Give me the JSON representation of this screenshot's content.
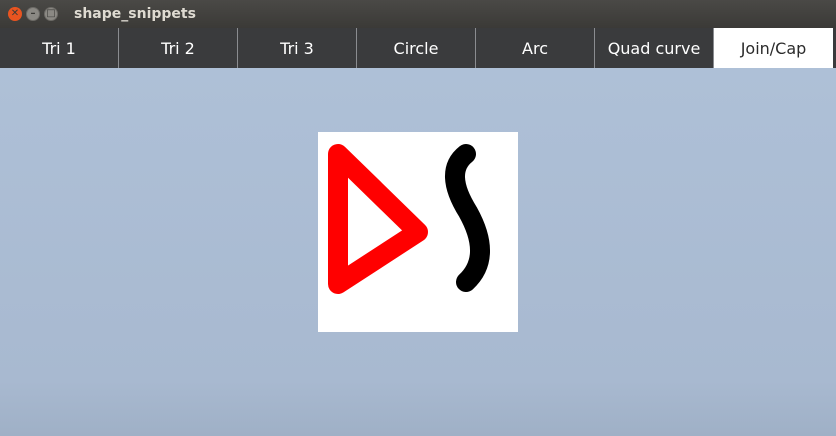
{
  "window": {
    "title": "shape_snippets",
    "close_glyph": "✕",
    "minimize_glyph": "–",
    "maximize_glyph": "□"
  },
  "tabs": [
    {
      "label": "Tri 1"
    },
    {
      "label": "Tri 2"
    },
    {
      "label": "Tri 3"
    },
    {
      "label": "Circle"
    },
    {
      "label": "Arc"
    },
    {
      "label": "Quad curve"
    },
    {
      "label": "Join/Cap",
      "active": true
    }
  ],
  "canvas": {
    "background": "#ffffff",
    "triangle": {
      "stroke": "#ff0000",
      "join": "round",
      "cap": "round"
    },
    "curve": {
      "stroke": "#000000",
      "join": "round",
      "cap": "round"
    }
  }
}
